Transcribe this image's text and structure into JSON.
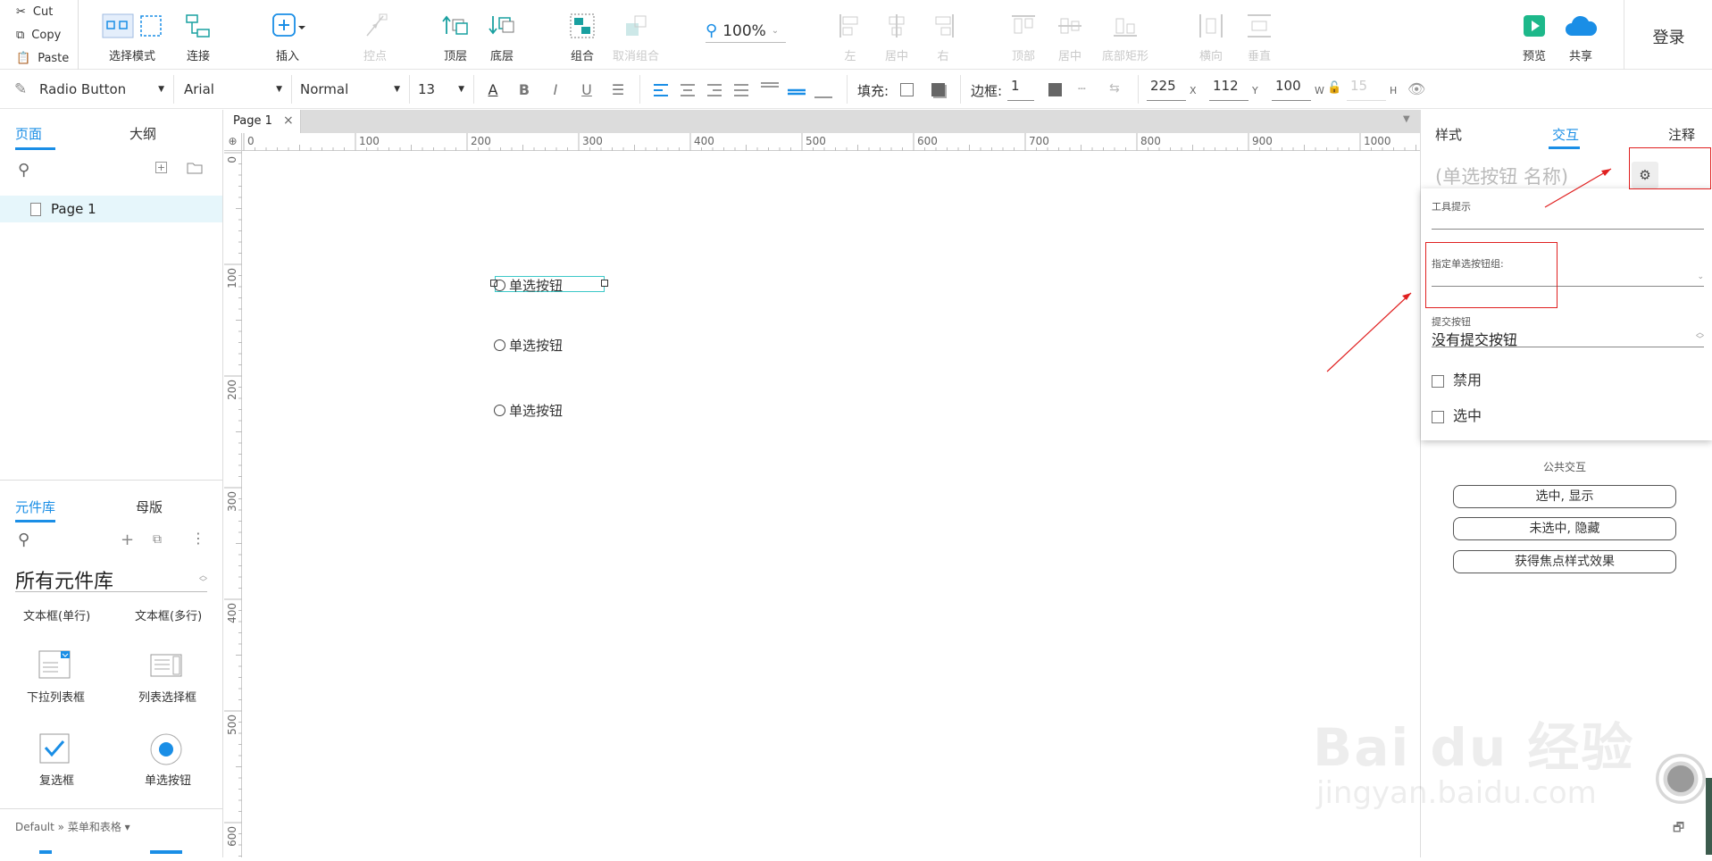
{
  "clipboard": {
    "cut": "Cut",
    "copy": "Copy",
    "paste": "Paste"
  },
  "toolbar": {
    "select_mode": "选择模式",
    "connect": "连接",
    "insert": "插入",
    "control_point": "控点",
    "front": "顶层",
    "back": "底层",
    "group": "组合",
    "ungroup": "取消组合",
    "zoom": "100%",
    "align_left": "左",
    "align_center": "居中",
    "align_right": "右",
    "align_top": "顶部",
    "align_middle": "居中",
    "align_bottom": "底部矩形",
    "distribute_h": "横向",
    "distribute_v": "垂直",
    "preview": "预览",
    "share": "共享",
    "login": "登录"
  },
  "format": {
    "widget_type": "Radio Button",
    "font": "Arial",
    "weight": "Normal",
    "size": "13",
    "fill_label": "填充:",
    "border_label": "边框:",
    "border_width": "1",
    "x": "225",
    "x_label": "X",
    "y": "112",
    "y_label": "Y",
    "w": "100",
    "w_label": "W",
    "h": "15",
    "h_label": "H"
  },
  "left_panel": {
    "tabs": [
      "页面",
      "大纲"
    ],
    "pages": [
      "Page 1"
    ],
    "lib_tabs": [
      "元件库",
      "母版"
    ],
    "library_name": "所有元件库",
    "widgets": [
      "文本框(单行)",
      "文本框(多行)",
      "下拉列表框",
      "列表选择框",
      "复选框",
      "单选按钮"
    ],
    "footer": "Default » 菜单和表格 ▾"
  },
  "canvas": {
    "tab": "Page 1",
    "close": "×",
    "ruler_top": [
      "0",
      "100",
      "200",
      "300",
      "400",
      "500",
      "600",
      "700",
      "800",
      "900",
      "1000"
    ],
    "ruler_left": [
      "0",
      "100",
      "200",
      "300",
      "400",
      "500",
      "600"
    ],
    "radios": [
      "单选按钮",
      "单选按钮",
      "单选按钮"
    ]
  },
  "right_panel": {
    "tabs": [
      "样式",
      "交互",
      "注释"
    ],
    "name_placeholder": "(单选按钮 名称)",
    "tooltip_label": "工具提示",
    "group_label": "指定单选按钮组:",
    "submit_label": "提交按钮",
    "submit_value": "没有提交按钮",
    "disabled": "禁用",
    "selected": "选中",
    "common_label": "公共交互",
    "actions": [
      "选中, 显示",
      "未选中, 隐藏",
      "获得焦点样式效果"
    ]
  },
  "watermark": {
    "brand": "Bai du 经验",
    "url": "jingyan.baidu.com"
  },
  "colors": {
    "accent": "#1a8ee6",
    "annotation": "#e02020",
    "selection": "#3cc8c8"
  }
}
